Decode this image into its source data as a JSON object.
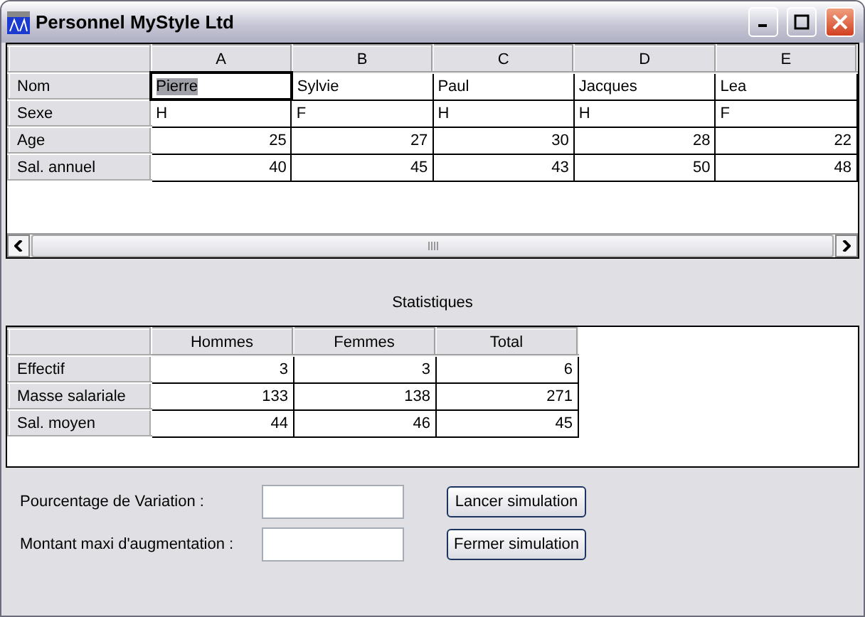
{
  "window": {
    "title": "Personnel MyStyle Ltd"
  },
  "grid": {
    "columns": [
      "A",
      "B",
      "C",
      "D",
      "E"
    ],
    "rows": [
      {
        "header": "Nom",
        "kind": "text",
        "cells": [
          {
            "text": "Pierre",
            "selected": true
          },
          {
            "text": "Sylvie",
            "selected": false
          },
          {
            "text": "Paul",
            "selected": false
          },
          {
            "text": "Jacques",
            "selected": false
          },
          {
            "text": "Lea",
            "selected": false
          }
        ]
      },
      {
        "header": "Sexe",
        "kind": "text",
        "cells": [
          {
            "text": "H",
            "selected": false
          },
          {
            "text": "F",
            "selected": false
          },
          {
            "text": "H",
            "selected": false
          },
          {
            "text": "H",
            "selected": false
          },
          {
            "text": "F",
            "selected": false
          }
        ]
      },
      {
        "header": "Age",
        "kind": "number",
        "cells": [
          {
            "text": "25",
            "selected": false
          },
          {
            "text": "27",
            "selected": false
          },
          {
            "text": "30",
            "selected": false
          },
          {
            "text": "28",
            "selected": false
          },
          {
            "text": "22",
            "selected": false
          }
        ]
      },
      {
        "header": "Sal. annuel",
        "kind": "number",
        "cells": [
          {
            "text": "40",
            "selected": false
          },
          {
            "text": "45",
            "selected": false
          },
          {
            "text": "43",
            "selected": false
          },
          {
            "text": "50",
            "selected": false
          },
          {
            "text": "48",
            "selected": false
          }
        ]
      }
    ]
  },
  "statistics": {
    "title": "Statistiques",
    "columns": [
      "Hommes",
      "Femmes",
      "Total"
    ],
    "rows": [
      {
        "header": "Effectif",
        "cells": [
          "3",
          "3",
          "6"
        ]
      },
      {
        "header": "Masse salariale",
        "cells": [
          "133",
          "138",
          "271"
        ]
      },
      {
        "header": "Sal. moyen",
        "cells": [
          "44",
          "46",
          "45"
        ]
      }
    ]
  },
  "form": [
    {
      "label": "Pourcentage de Variation :",
      "button": "Lancer simulation"
    },
    {
      "label": "Montant maxi d'augmentation :",
      "button": "Fermer simulation"
    }
  ]
}
